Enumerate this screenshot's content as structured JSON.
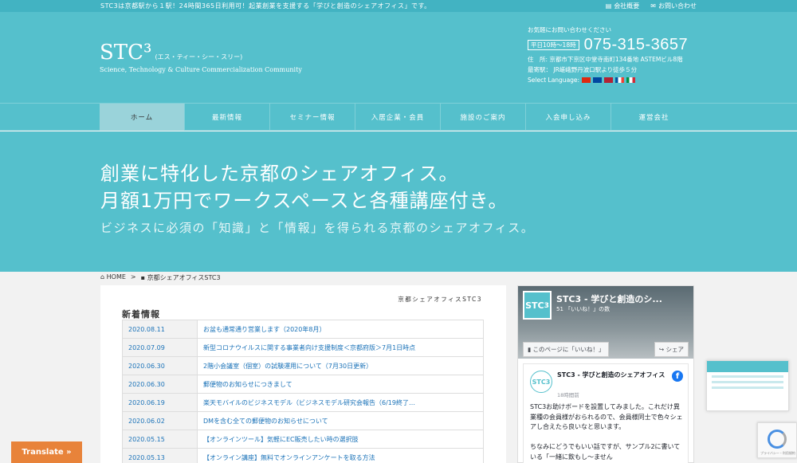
{
  "topbar": {
    "tagline": "STC3は京都駅から１駅！24時間365日利用可！起業創業を支援する「学びと創造のシェアオフィス」です。",
    "company_label": "会社概要",
    "contact_label": "お問い合わせ"
  },
  "header": {
    "logo_name": "STC³",
    "logo_kana": "(エス・ティー・シー・スリー)",
    "logo_sub": "Science, Technology & Culture Commercialization Community",
    "contact_prompt": "お気軽にお問い合わせください",
    "hours": "平日10時〜18時",
    "phone": "075-315-3657",
    "address": "住　所: 京都市下京区中堂寺南町134番地 ASTEMビル8階",
    "station": "最寄駅：  JR嵯峨野丹波口駅より徒歩５分",
    "language_label": "Select Language:",
    "flag_colors": [
      "#de2910",
      "#0047a0",
      "#b22234",
      "#0055a4",
      "#009246"
    ]
  },
  "nav": {
    "items": [
      "ホーム",
      "最新情報",
      "セミナー情報",
      "入居企業・会員",
      "施設のご案内",
      "入会申し込み",
      "運営会社"
    ]
  },
  "hero": {
    "line1": "創業に特化した京都のシェアオフィス。",
    "line2": "月額1万円でワークスペースと各種講座付き。",
    "sub": "ビジネスに必須の「知識」と「情報」を得られる京都のシェアオフィス。"
  },
  "breadcrumb": {
    "home": "HOME",
    "sep": ">",
    "current": "京都シェアオフィスSTC3"
  },
  "main": {
    "site_title": "京都シェアオフィスSTC3",
    "news_heading": "新着情報",
    "news": [
      {
        "date": "2020.08.11",
        "title": "お盆も通常通り営業します（2020年8月）"
      },
      {
        "date": "2020.07.09",
        "title": "新型コロナウイルスに関する事業者向け支援制度＜京都府版＞7月1日時点"
      },
      {
        "date": "2020.06.30",
        "title": "2階小会議室（個室）の試験運用について（7月30日更新）"
      },
      {
        "date": "2020.06.30",
        "title": "郵便物のお知らせにつきまして"
      },
      {
        "date": "2020.06.19",
        "title": "楽天モバイルのビジネスモデル（ビジネスモデル研究会報告（6/19終了…"
      },
      {
        "date": "2020.06.02",
        "title": "DMを含む全ての郵便物のお知らせについて"
      },
      {
        "date": "2020.05.15",
        "title": "【オンラインツール】気軽にEC販売したい時の選択肢"
      },
      {
        "date": "2020.05.13",
        "title": "【オンライン講座】無料でオンラインアンケートを取る方法"
      }
    ]
  },
  "facebook": {
    "page_name": "STC3 - 学びと創造のシ...",
    "likes": "51 「いいね！」の数",
    "like_button": "このページに「いいね！」",
    "share_button": "シェア",
    "post_name": "STC3 - 学びと創造のシェアオフィス",
    "post_time": "18時間前",
    "post_body": "STC3お助けボードを設置してみました。これだけ異業種の会員様がおられるので、会員様同士で色々シェアし合えたら良いなと思います。\n\nちなみにどうでもいい話ですが、サンプル2に書いている「一緒に飲もし～ません",
    "logo_text": "STC3"
  },
  "recaptcha": {
    "text": "プライバシー・利用規約"
  },
  "translate": {
    "label": "Translate »"
  },
  "colors": {
    "brand": "#55c0cc",
    "topbar": "#42b3c2",
    "link": "#1a72b8",
    "translate": "#e8833a"
  }
}
